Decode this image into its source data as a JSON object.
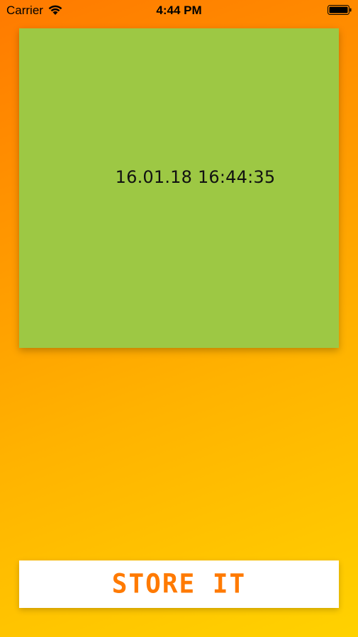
{
  "status_bar": {
    "carrier": "Carrier",
    "time": "4:44 PM",
    "wifi_icon": "wifi-icon",
    "battery_icon": "battery-icon"
  },
  "card": {
    "timestamp": "16.01.18 16:44:35",
    "background_color": "#9dc844"
  },
  "button": {
    "label": "STORE IT",
    "text_color": "#ff7a00",
    "background_color": "#ffffff"
  },
  "background": {
    "gradient_from": "#ff7a00",
    "gradient_to": "#ffd200"
  }
}
